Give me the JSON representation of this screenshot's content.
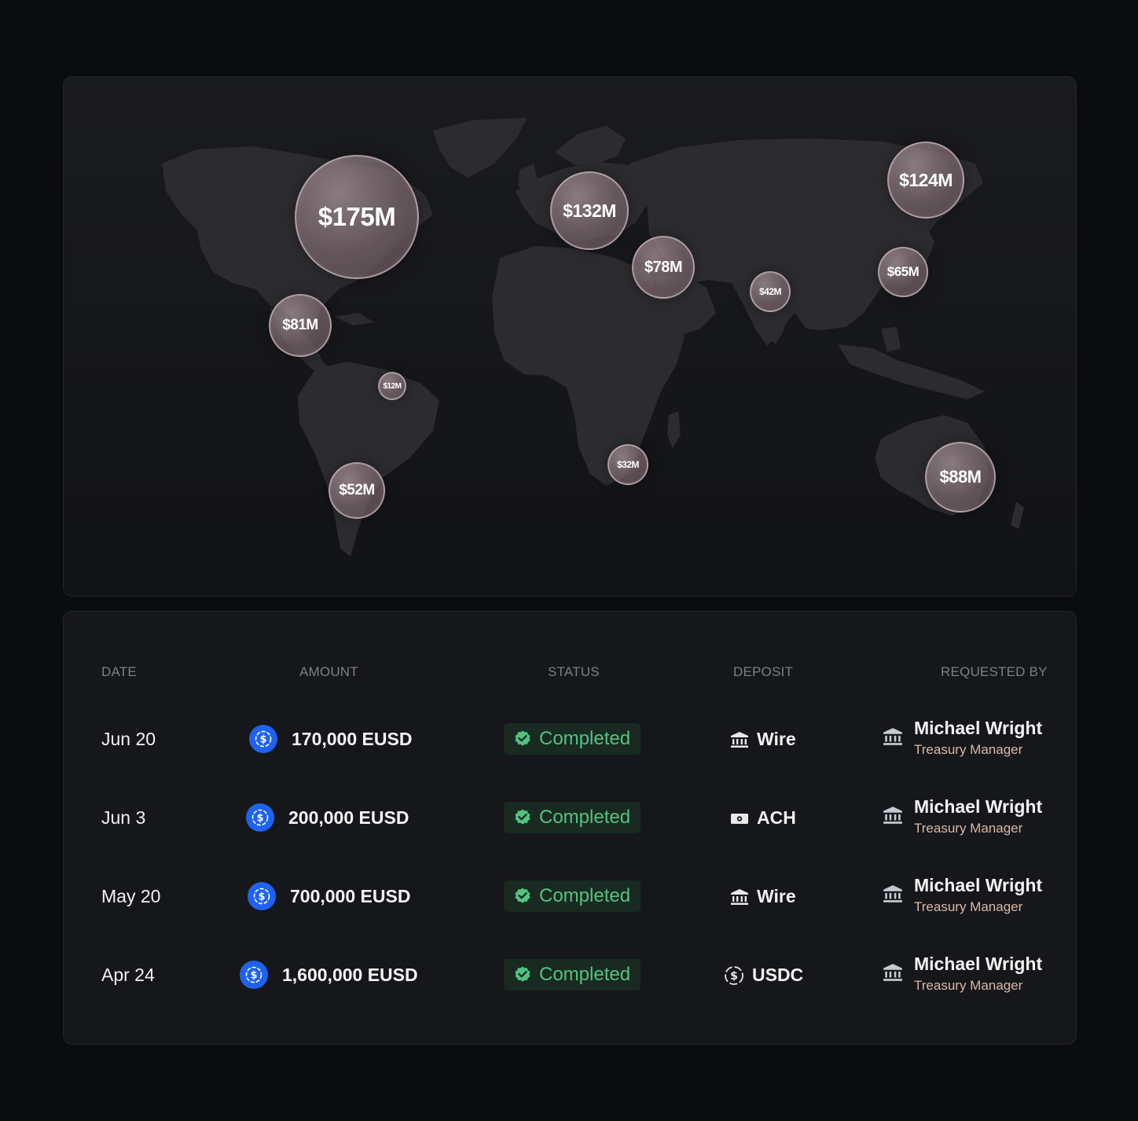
{
  "map": {
    "bubbles": [
      {
        "label": "$175M"
      },
      {
        "label": "$132M"
      },
      {
        "label": "$124M"
      },
      {
        "label": "$78M"
      },
      {
        "label": "$65M"
      },
      {
        "label": "$42M"
      },
      {
        "label": "$81M"
      },
      {
        "label": "$12M"
      },
      {
        "label": "$52M"
      },
      {
        "label": "$32M"
      },
      {
        "label": "$88M"
      }
    ]
  },
  "table": {
    "headers": {
      "date": "DATE",
      "amount": "AMOUNT",
      "status": "STATUS",
      "deposit": "DEPOSIT",
      "requested_by": "REQUESTED BY"
    },
    "rows": [
      {
        "date": "Jun 20",
        "amount": "170,000 EUSD",
        "status": "Completed",
        "deposit": "Wire",
        "deposit_icon": "bank-icon",
        "name": "Michael Wright",
        "role": "Treasury Manager"
      },
      {
        "date": "Jun 3",
        "amount": "200,000 EUSD",
        "status": "Completed",
        "deposit": "ACH",
        "deposit_icon": "cash-icon",
        "name": "Michael Wright",
        "role": "Treasury Manager"
      },
      {
        "date": "May 20",
        "amount": "700,000 EUSD",
        "status": "Completed",
        "deposit": "Wire",
        "deposit_icon": "bank-icon",
        "name": "Michael Wright",
        "role": "Treasury Manager"
      },
      {
        "date": "Apr 24",
        "amount": "1,600,000 EUSD",
        "status": "Completed",
        "deposit": "USDC",
        "deposit_icon": "dollar-circle-icon",
        "name": "Michael Wright",
        "role": "Treasury Manager"
      }
    ]
  },
  "colors": {
    "background": "#0b0c0f",
    "panel": "#16171b",
    "status_green": "#54c27f",
    "status_bg": "#182a22",
    "coin_blue": "#1e63f0",
    "role_text": "#d9b8a6"
  }
}
